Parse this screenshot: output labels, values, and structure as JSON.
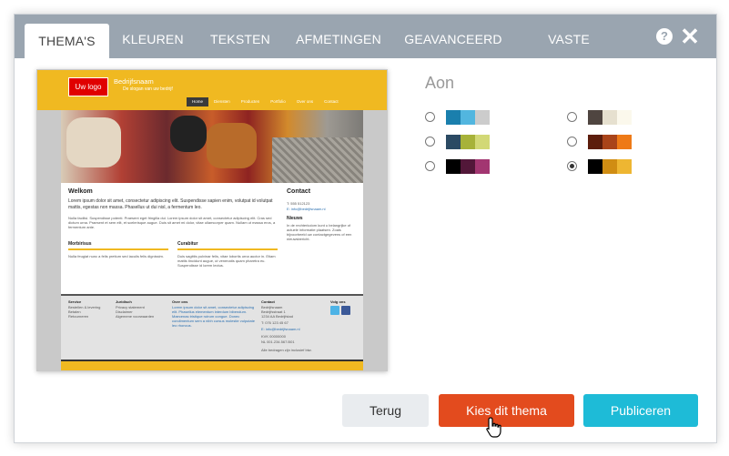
{
  "tabs": [
    {
      "label": "THEMA'S",
      "active": true
    },
    {
      "label": "KLEUREN",
      "active": false
    },
    {
      "label": "TEKSTEN",
      "active": false
    },
    {
      "label": "AFMETINGEN",
      "active": false
    },
    {
      "label": "GEAVANCEERD",
      "active": false
    },
    {
      "label": "VASTE STIJLEN",
      "active": false
    }
  ],
  "header": {
    "help_label": "?",
    "close_label": "✕"
  },
  "preview": {
    "logo": "Uw logo",
    "site_name": "Bedrijfsnaam",
    "slogan": "De slogan van uw bedrijf",
    "nav": [
      "Home",
      "Diensten",
      "Producten",
      "Portfolio",
      "Over ons",
      "Contact"
    ],
    "welcome_title": "Welkom",
    "welcome_lead": "Lorem ipsum dolor sit amet, consectetur adipiscing elit. Suspendisse sapien enim, volutpat id volutpat mattis, egestas non massa. Phasellus ut dui nisl, a fermentum leo.",
    "welcome_body": "Nulla facilisi. Suspendisse potenti. Praesent eget fringilla dui. Lorem ipsum dolor sit amet, consectetur adipiscing elit. Cras sed dictum urna. Praesent et sem elit, et scelerisque augue. Duis sit amet mi dolor, vitae ullamcorper quam. Nullam ut massa eros, a fermentum ante.",
    "col1_title": "Morbirisus",
    "col1_text": "Nulla feugiat nunc a felis pretium sed iaculis felis dignissim.",
    "col2_title": "Curabitur",
    "col2_text": "Duis sagittis pulvinar felis, vitae lobortis urna auctor in. Etiam mattis tincidunt augue, ut venenatis quam pharetra eu. Suspendisse id lorem lectus.",
    "contact_title": "Contact",
    "contact_phone": "T: 555 512123",
    "contact_email": "E: info@bedrijfsnaam.nl",
    "news_title": "Nieuws",
    "news_text": "In de rechterkolom kunt u belangrijke of actuele informatie plaatsen. Zoals bijvoorbeeld uw contactgegevens of een nieuwsbericht.",
    "footer": {
      "service_title": "Service",
      "service_items": [
        "Bestellen & levering",
        "Betalen",
        "Retourneren"
      ],
      "legal_title": "Juridisch",
      "legal_items": [
        "Privacy statement",
        "Disclaimer",
        "Algemene voorwaarden"
      ],
      "about_title": "Over ons",
      "about_text": "Lorem ipsum dolor sit amet, consectetur adipiscing elit. Phasellus elementum interdum bibendum. Maecenas tristique rutrum congue. Donec condimentum sem a nibh cursus molestie vulputate leo rhoncus.",
      "contact_title": "Contact",
      "contact_lines": [
        "Bedrijfsnaam",
        "Bedrijfsstraat 1",
        "1234 AA Bedrijfstad",
        "T: 076 123 45 67",
        "E: info@bedrijfsnaam.nl",
        "KVK 00000000",
        "NL 001.234.567.B01",
        "Alle bedragen zijn inclusief btw."
      ],
      "follow_title": "Volg ons"
    }
  },
  "theme_name": "Aon",
  "color_options": [
    {
      "colors": [
        "#1a7fad",
        "#52b6df",
        "#cccccc"
      ],
      "selected": false
    },
    {
      "colors": [
        "#4f4540",
        "#e6e0cf",
        "#fbf8ec"
      ],
      "selected": false
    },
    {
      "colors": [
        "#2b4a63",
        "#a7b239",
        "#d2d876"
      ],
      "selected": false
    },
    {
      "colors": [
        "#5c1d0c",
        "#a9441a",
        "#ee7a17"
      ],
      "selected": false
    },
    {
      "colors": [
        "#000000",
        "#521739",
        "#a23671"
      ],
      "selected": false
    },
    {
      "colors": [
        "#000000",
        "#d08d13",
        "#eeb632"
      ],
      "selected": true
    }
  ],
  "buttons": {
    "back": "Terug",
    "choose": "Kies dit thema",
    "publish": "Publiceren"
  },
  "colors": {
    "tabbar": "#9aa5b0",
    "choose": "#e34b1e",
    "publish": "#1ebbd7",
    "back": "#e9ecef",
    "theme_yellow": "#f0b921"
  }
}
